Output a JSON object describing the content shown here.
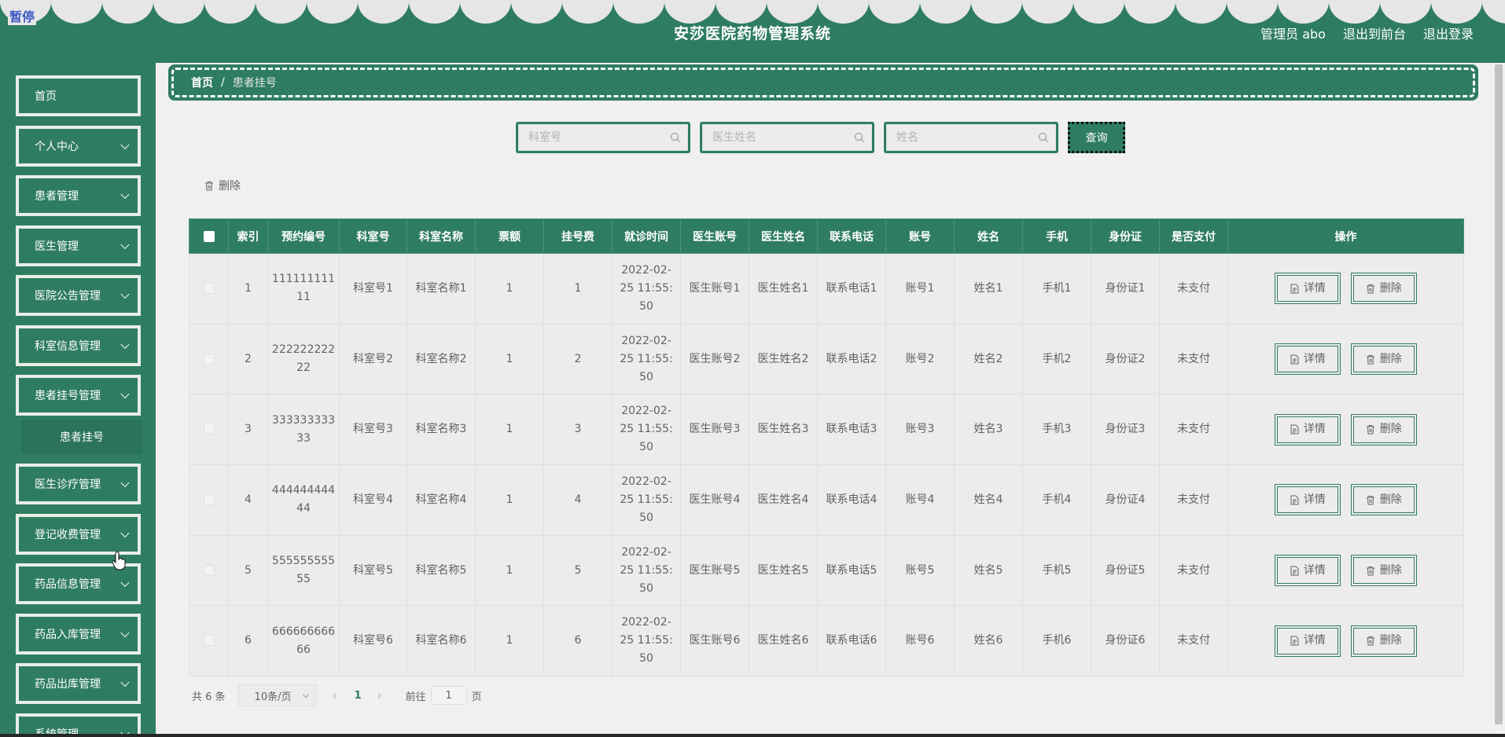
{
  "header": {
    "paused_label": "暂停",
    "title": "安莎医院药物管理系统",
    "admin_label": "管理员 abo",
    "front_link": "退出到前台",
    "logout_link": "退出登录"
  },
  "sidebar": {
    "items": [
      {
        "label": "首页",
        "has_arrow": false
      },
      {
        "label": "个人中心",
        "has_arrow": true
      },
      {
        "label": "患者管理",
        "has_arrow": true
      },
      {
        "label": "医生管理",
        "has_arrow": true
      },
      {
        "label": "医院公告管理",
        "has_arrow": true
      },
      {
        "label": "科室信息管理",
        "has_arrow": true
      },
      {
        "label": "患者挂号管理",
        "has_arrow": true
      },
      {
        "label": "医生诊疗管理",
        "has_arrow": true
      },
      {
        "label": "登记收费管理",
        "has_arrow": true
      },
      {
        "label": "药品信息管理",
        "has_arrow": true
      },
      {
        "label": "药品入库管理",
        "has_arrow": true
      },
      {
        "label": "药品出库管理",
        "has_arrow": true
      },
      {
        "label": "系统管理",
        "has_arrow": true
      }
    ],
    "submenu_item": "患者挂号"
  },
  "breadcrumb": {
    "home": "首页",
    "separator": "/",
    "current": "患者挂号"
  },
  "search": {
    "dept_no_placeholder": "科室号",
    "doctor_name_placeholder": "医生姓名",
    "name_placeholder": "姓名",
    "query_button": "查询"
  },
  "toolbar": {
    "delete_label": "删除"
  },
  "table": {
    "columns": [
      "索引",
      "预约编号",
      "科室号",
      "科室名称",
      "票额",
      "挂号费",
      "就诊时间",
      "医生账号",
      "医生姓名",
      "联系电话",
      "账号",
      "姓名",
      "手机",
      "身份证",
      "是否支付",
      "操作"
    ],
    "detail_label": "详情",
    "delete_label": "删除",
    "rows": [
      {
        "index": "1",
        "appt_no_line1": "111111111",
        "appt_no_line2": "11",
        "dept_no": "科室号1",
        "dept_name": "科室名称1",
        "ticket": "1",
        "fee": "1",
        "time_line1": "2022-02-",
        "time_line2": "25 11:55:",
        "time_line3": "50",
        "doctor_account": "医生账号1",
        "doctor_name": "医生姓名1",
        "phone": "联系电话1",
        "account": "账号1",
        "name": "姓名1",
        "mobile": "手机1",
        "id_card": "身份证1",
        "paid": "未支付"
      },
      {
        "index": "2",
        "appt_no_line1": "222222222",
        "appt_no_line2": "22",
        "dept_no": "科室号2",
        "dept_name": "科室名称2",
        "ticket": "1",
        "fee": "2",
        "time_line1": "2022-02-",
        "time_line2": "25 11:55:",
        "time_line3": "50",
        "doctor_account": "医生账号2",
        "doctor_name": "医生姓名2",
        "phone": "联系电话2",
        "account": "账号2",
        "name": "姓名2",
        "mobile": "手机2",
        "id_card": "身份证2",
        "paid": "未支付"
      },
      {
        "index": "3",
        "appt_no_line1": "333333333",
        "appt_no_line2": "33",
        "dept_no": "科室号3",
        "dept_name": "科室名称3",
        "ticket": "1",
        "fee": "3",
        "time_line1": "2022-02-",
        "time_line2": "25 11:55:",
        "time_line3": "50",
        "doctor_account": "医生账号3",
        "doctor_name": "医生姓名3",
        "phone": "联系电话3",
        "account": "账号3",
        "name": "姓名3",
        "mobile": "手机3",
        "id_card": "身份证3",
        "paid": "未支付"
      },
      {
        "index": "4",
        "appt_no_line1": "444444444",
        "appt_no_line2": "44",
        "dept_no": "科室号4",
        "dept_name": "科室名称4",
        "ticket": "1",
        "fee": "4",
        "time_line1": "2022-02-",
        "time_line2": "25 11:55:",
        "time_line3": "50",
        "doctor_account": "医生账号4",
        "doctor_name": "医生姓名4",
        "phone": "联系电话4",
        "account": "账号4",
        "name": "姓名4",
        "mobile": "手机4",
        "id_card": "身份证4",
        "paid": "未支付"
      },
      {
        "index": "5",
        "appt_no_line1": "555555555",
        "appt_no_line2": "55",
        "dept_no": "科室号5",
        "dept_name": "科室名称5",
        "ticket": "1",
        "fee": "5",
        "time_line1": "2022-02-",
        "time_line2": "25 11:55:",
        "time_line3": "50",
        "doctor_account": "医生账号5",
        "doctor_name": "医生姓名5",
        "phone": "联系电话5",
        "account": "账号5",
        "name": "姓名5",
        "mobile": "手机5",
        "id_card": "身份证5",
        "paid": "未支付"
      },
      {
        "index": "6",
        "appt_no_line1": "666666666",
        "appt_no_line2": "66",
        "dept_no": "科室号6",
        "dept_name": "科室名称6",
        "ticket": "1",
        "fee": "6",
        "time_line1": "2022-02-",
        "time_line2": "25 11:55:",
        "time_line3": "50",
        "doctor_account": "医生账号6",
        "doctor_name": "医生姓名6",
        "phone": "联系电话6",
        "account": "账号6",
        "name": "姓名6",
        "mobile": "手机6",
        "id_card": "身份证6",
        "paid": "未支付"
      }
    ]
  },
  "pagination": {
    "total_text": "共 6 条",
    "page_size": "10条/页",
    "current_page": "1",
    "goto_prefix": "前往",
    "goto_value": "1",
    "goto_suffix": "页"
  },
  "colors": {
    "primary": "#2f7d60",
    "background": "#f0f0f0",
    "text": "#606266"
  }
}
